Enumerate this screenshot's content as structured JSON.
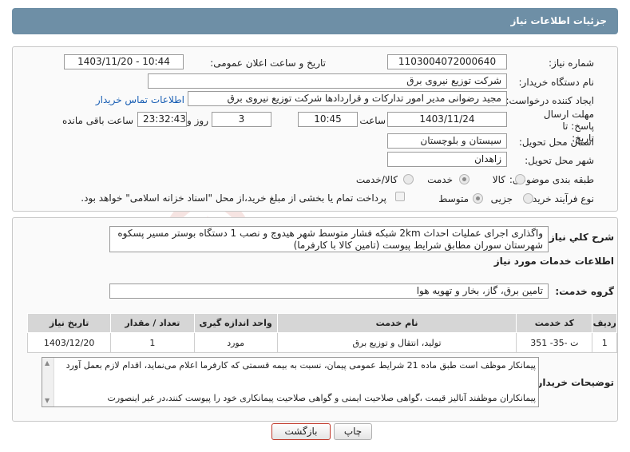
{
  "header": {
    "title": "جزئیات اطلاعات نیاز"
  },
  "labels": {
    "need_number": "شماره نیاز:",
    "announce_datetime": "تاریخ و ساعت اعلان عمومی:",
    "buyer_org": "نام دستگاه خریدار:",
    "requester": "ایجاد کننده درخواست:",
    "deadline": "مهلت ارسال پاسخ: تا تاریخ:",
    "time": "ساعت",
    "day_and": "روز و",
    "remaining": "ساعت باقی مانده",
    "province": "استان محل تحویل:",
    "city": "شهر محل تحویل:",
    "category": "طبقه بندی موضوعی:",
    "purchase_type": "نوع فرآیند خرید :",
    "general_desc": "شرح کلي نیاز:",
    "services_info": "اطلاعات خدمات مورد نیاز",
    "service_group": "گروه خدمت:",
    "buyer_notes": "توضیحات خریدار:"
  },
  "values": {
    "need_number": "1103004072000640",
    "announce_datetime": "1403/11/20 - 10:44",
    "buyer_org": "شرکت توزیع نیروی برق",
    "requester": "مجید  رضوانی مدیر امور تدارکات و قراردادها شرکت توزیع نیروی برق",
    "contact_link": "اطلاعات تماس خریدار",
    "deadline_date": "1403/11/24",
    "deadline_time": "10:45",
    "days": "3",
    "remaining_time": "23:32:43",
    "province": "سیستان و بلوچستان",
    "city": "زاهدان"
  },
  "category_options": [
    {
      "label": "کالا",
      "selected": false
    },
    {
      "label": "خدمت",
      "selected": true
    },
    {
      "label": "کالا/خدمت",
      "selected": false
    }
  ],
  "purchase_options": [
    {
      "label": "جزیی",
      "selected": false
    },
    {
      "label": "متوسط",
      "selected": true
    }
  ],
  "payment_note": "پرداخت تمام یا بخشی از مبلغ خرید،از محل \"اسناد خزانه اسلامی\" خواهد بود.",
  "general_description": "واگذاری اجرای عملیات احداث 2km شبکه فشار متوسط شهر هیدوچ و نصب 1 دستگاه بوستر مسیر پسکوه شهرستان سوران مطابق شرایط پیوست (تامین کالا با کارفرما)",
  "service_group_value": "تامین برق، گاز، بخار و تهویه هوا",
  "table": {
    "headers": [
      "ردیف",
      "کد خدمت",
      "نام خدمت",
      "واحد اندازه گیری",
      "تعداد / مقدار",
      "تاریخ نیاز"
    ],
    "rows": [
      [
        "1",
        "ت -35- 351",
        "تولید، انتقال و توزیع برق",
        "مورد",
        "1",
        "1403/12/20"
      ]
    ]
  },
  "buyer_notes": [
    "پیمانکار موظف است طبق ماده 21 شرایط عمومی پیمان، نسبت به بیمه قسمتی که کارفرما اعلام می‌نماید، اقدام لازم بعمل آورد",
    "پیمانکاران موظفند آنالیز قیمت ،گواهی صلاحیت ایمنی و گواهی صلاحیت پیمانکاری خود را پیوست کنند،در غیر اینصورت"
  ],
  "buttons": {
    "print": "چاپ",
    "back": "بازگشت"
  },
  "watermark": "AriaTender.neT",
  "colors": {
    "header": "#6e8fa6",
    "link": "#1a5fb4",
    "back_button_border": "#c0392b"
  }
}
